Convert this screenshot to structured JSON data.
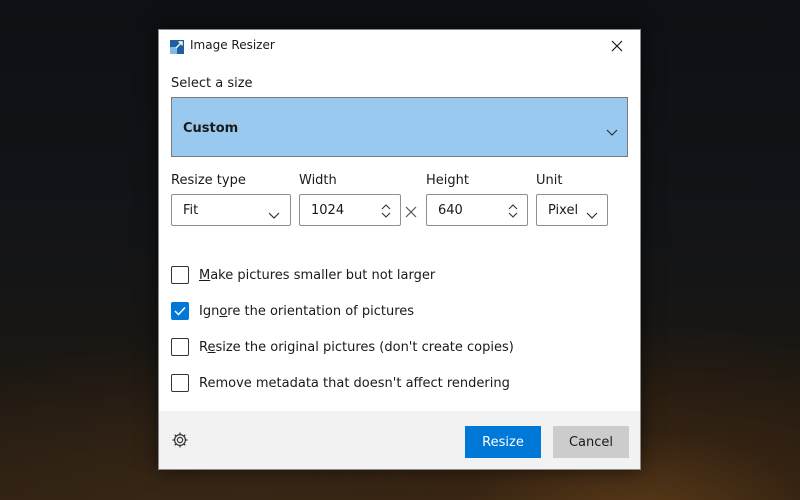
{
  "window": {
    "title": "Image Resizer"
  },
  "size": {
    "label": "Select a size",
    "selected": "Custom"
  },
  "resize_type": {
    "label": "Resize type",
    "value": "Fit"
  },
  "width": {
    "label": "Width",
    "value": "1024"
  },
  "height": {
    "label": "Height",
    "value": "640"
  },
  "unit": {
    "label": "Unit",
    "value": "Pixel"
  },
  "options": [
    {
      "pre": "",
      "mn": "M",
      "post": "ake pictures smaller but not larger",
      "checked": false
    },
    {
      "pre": "Ign",
      "mn": "o",
      "post": "re the orientation of pictures",
      "checked": true
    },
    {
      "pre": "R",
      "mn": "e",
      "post": "size the original pictures (don't create copies)",
      "checked": false
    },
    {
      "pre": "Remove metadata that doesn't affect rendering",
      "mn": "",
      "post": "",
      "checked": false
    }
  ],
  "footer": {
    "resize_label": "Resize",
    "cancel_label": "Cancel"
  },
  "icons": {
    "app": "image-resizer-icon",
    "close": "close-icon",
    "settings": "gear-icon",
    "chevron": "chevron-down-icon",
    "spinner": "up-down-spinner-icon",
    "times": "multiply-icon"
  },
  "colors": {
    "accent": "#0078d7",
    "selected_bg": "#99c9ef",
    "footer_bg": "#f2f2f2"
  }
}
